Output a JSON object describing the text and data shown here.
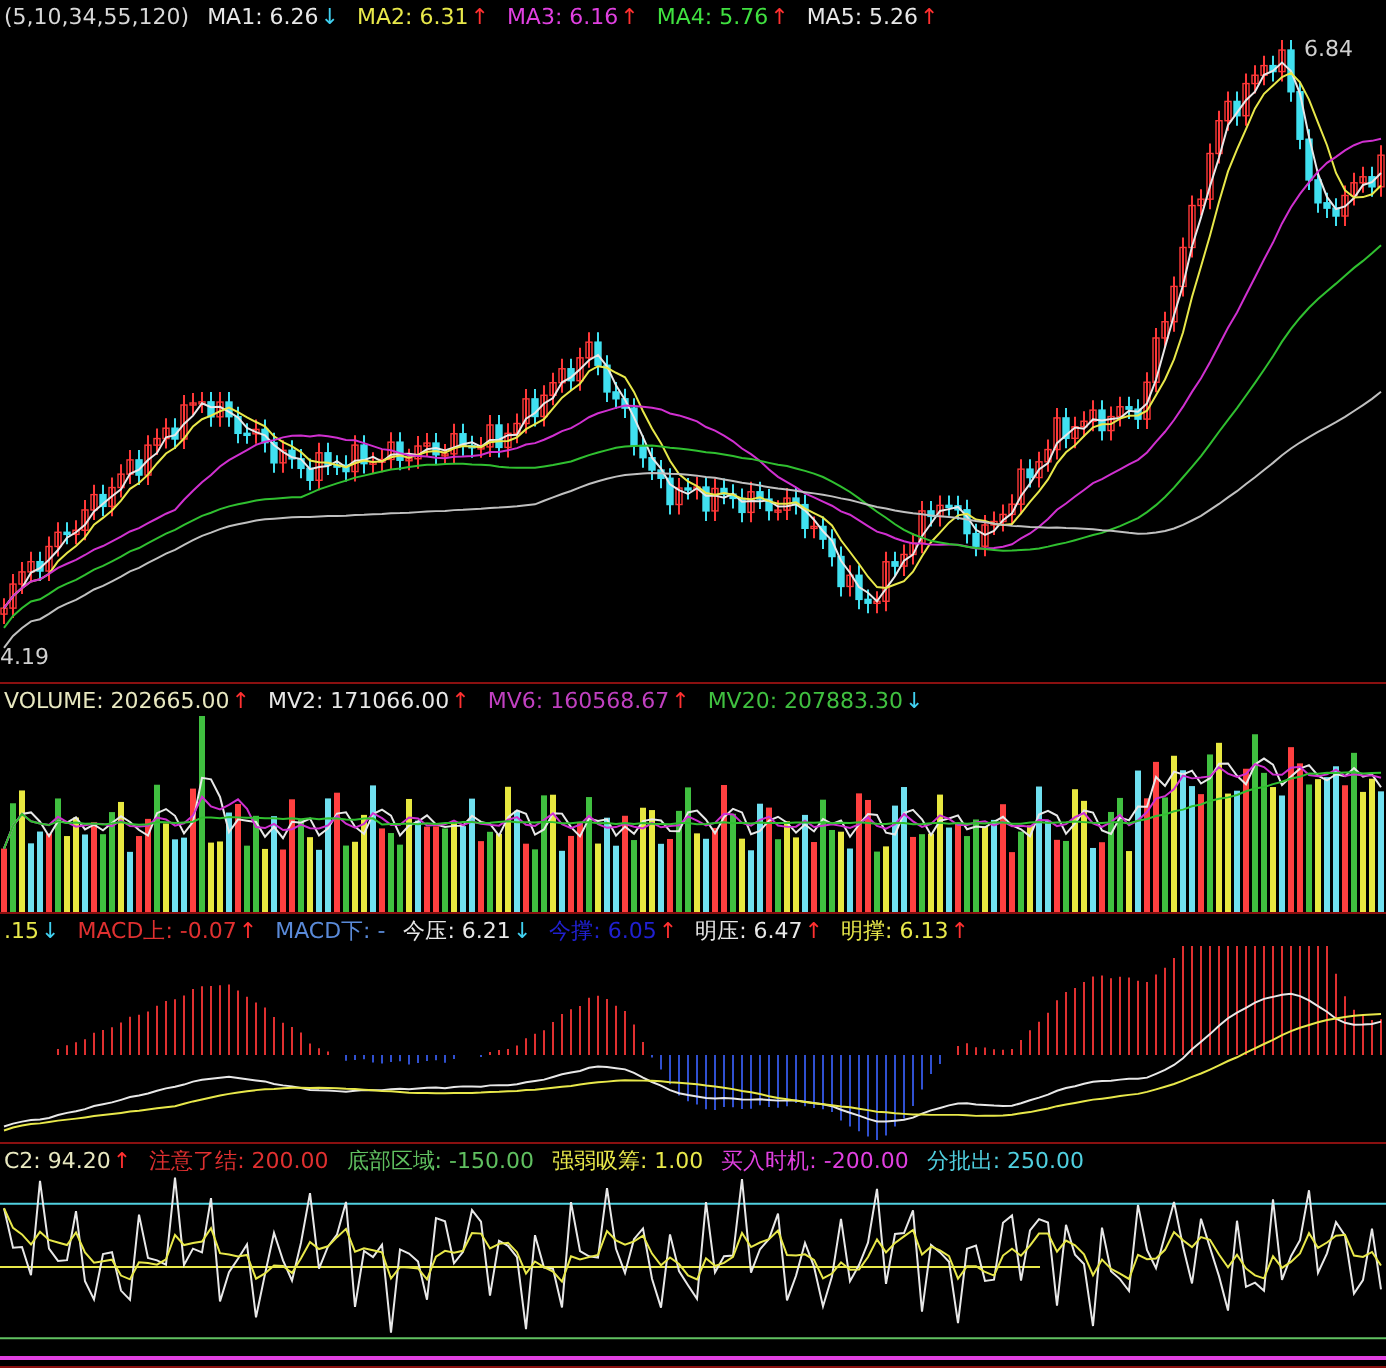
{
  "price_panel": {
    "legend": [
      {
        "text": "(5,10,34,55,120)",
        "color": "#d8d8d8"
      },
      {
        "text": "MA1: 6.26",
        "color": "#e8e8e8",
        "arrow": {
          "text": "↓",
          "color": "#40d0f0"
        }
      },
      {
        "text": "MA2: 6.31",
        "color": "#e8e84a",
        "arrow": {
          "text": "↑",
          "color": "#ff3030"
        }
      },
      {
        "text": "MA3: 6.16",
        "color": "#e040e0",
        "arrow": {
          "text": "↑",
          "color": "#ff3030"
        }
      },
      {
        "text": "MA4: 5.76",
        "color": "#40e040",
        "arrow": {
          "text": "↑",
          "color": "#ff3030"
        }
      },
      {
        "text": "MA5: 5.26",
        "color": "#e8e8e8",
        "arrow": {
          "text": "↑",
          "color": "#ff3030"
        }
      }
    ],
    "high_label": "6.84",
    "low_label": "4.19"
  },
  "volume_panel": {
    "legend": [
      {
        "text": "VOLUME: 202665.00",
        "color": "#e8e8c0",
        "arrow": {
          "text": "↑",
          "color": "#ff3030"
        }
      },
      {
        "text": "MV2: 171066.00",
        "color": "#e8e8e8",
        "arrow": {
          "text": "↑",
          "color": "#ff3030"
        }
      },
      {
        "text": "MV6: 160568.67",
        "color": "#c040c0",
        "arrow": {
          "text": "↑",
          "color": "#ff3030"
        }
      },
      {
        "text": "MV20: 207883.30",
        "color": "#40c040",
        "arrow": {
          "text": "↓",
          "color": "#40d0f0"
        }
      }
    ]
  },
  "macd_panel": {
    "legend": [
      {
        "text": ".15",
        "color": "#e8e84a",
        "arrow": {
          "text": "↓",
          "color": "#40d0f0"
        }
      },
      {
        "text": "MACD上: -0.07",
        "color": "#e03030",
        "arrow": {
          "text": "↑",
          "color": "#ff3030"
        }
      },
      {
        "text": "MACD下: -",
        "color": "#5a8ad8"
      },
      {
        "text": "今压: 6.21",
        "color": "#e8e8e8",
        "arrow": {
          "text": "↓",
          "color": "#40d0f0"
        }
      },
      {
        "text": "今撑: 6.05",
        "color": "#2020d0",
        "arrow": {
          "text": "↑",
          "color": "#ff3030"
        }
      },
      {
        "text": "明压: 6.47",
        "color": "#e8e8e8",
        "arrow": {
          "text": "↑",
          "color": "#ff3030"
        }
      },
      {
        "text": "明撑: 6.13",
        "color": "#e8e84a",
        "arrow": {
          "text": "↑",
          "color": "#ff3030"
        }
      }
    ]
  },
  "indicator_panel": {
    "legend": [
      {
        "text": "C2: 94.20",
        "color": "#e8e8c0",
        "arrow": {
          "text": "↑",
          "color": "#ff3030"
        }
      },
      {
        "text": "注意了结: 200.00",
        "color": "#e03030"
      },
      {
        "text": "底部区域: -150.00",
        "color": "#60c060"
      },
      {
        "text": "强弱吸筹: 1.00",
        "color": "#e8e84a"
      },
      {
        "text": "买入时机: -200.00",
        "color": "#e040e0"
      },
      {
        "text": "分批出: 250.00",
        "color": "#50d0e0"
      }
    ]
  }
}
